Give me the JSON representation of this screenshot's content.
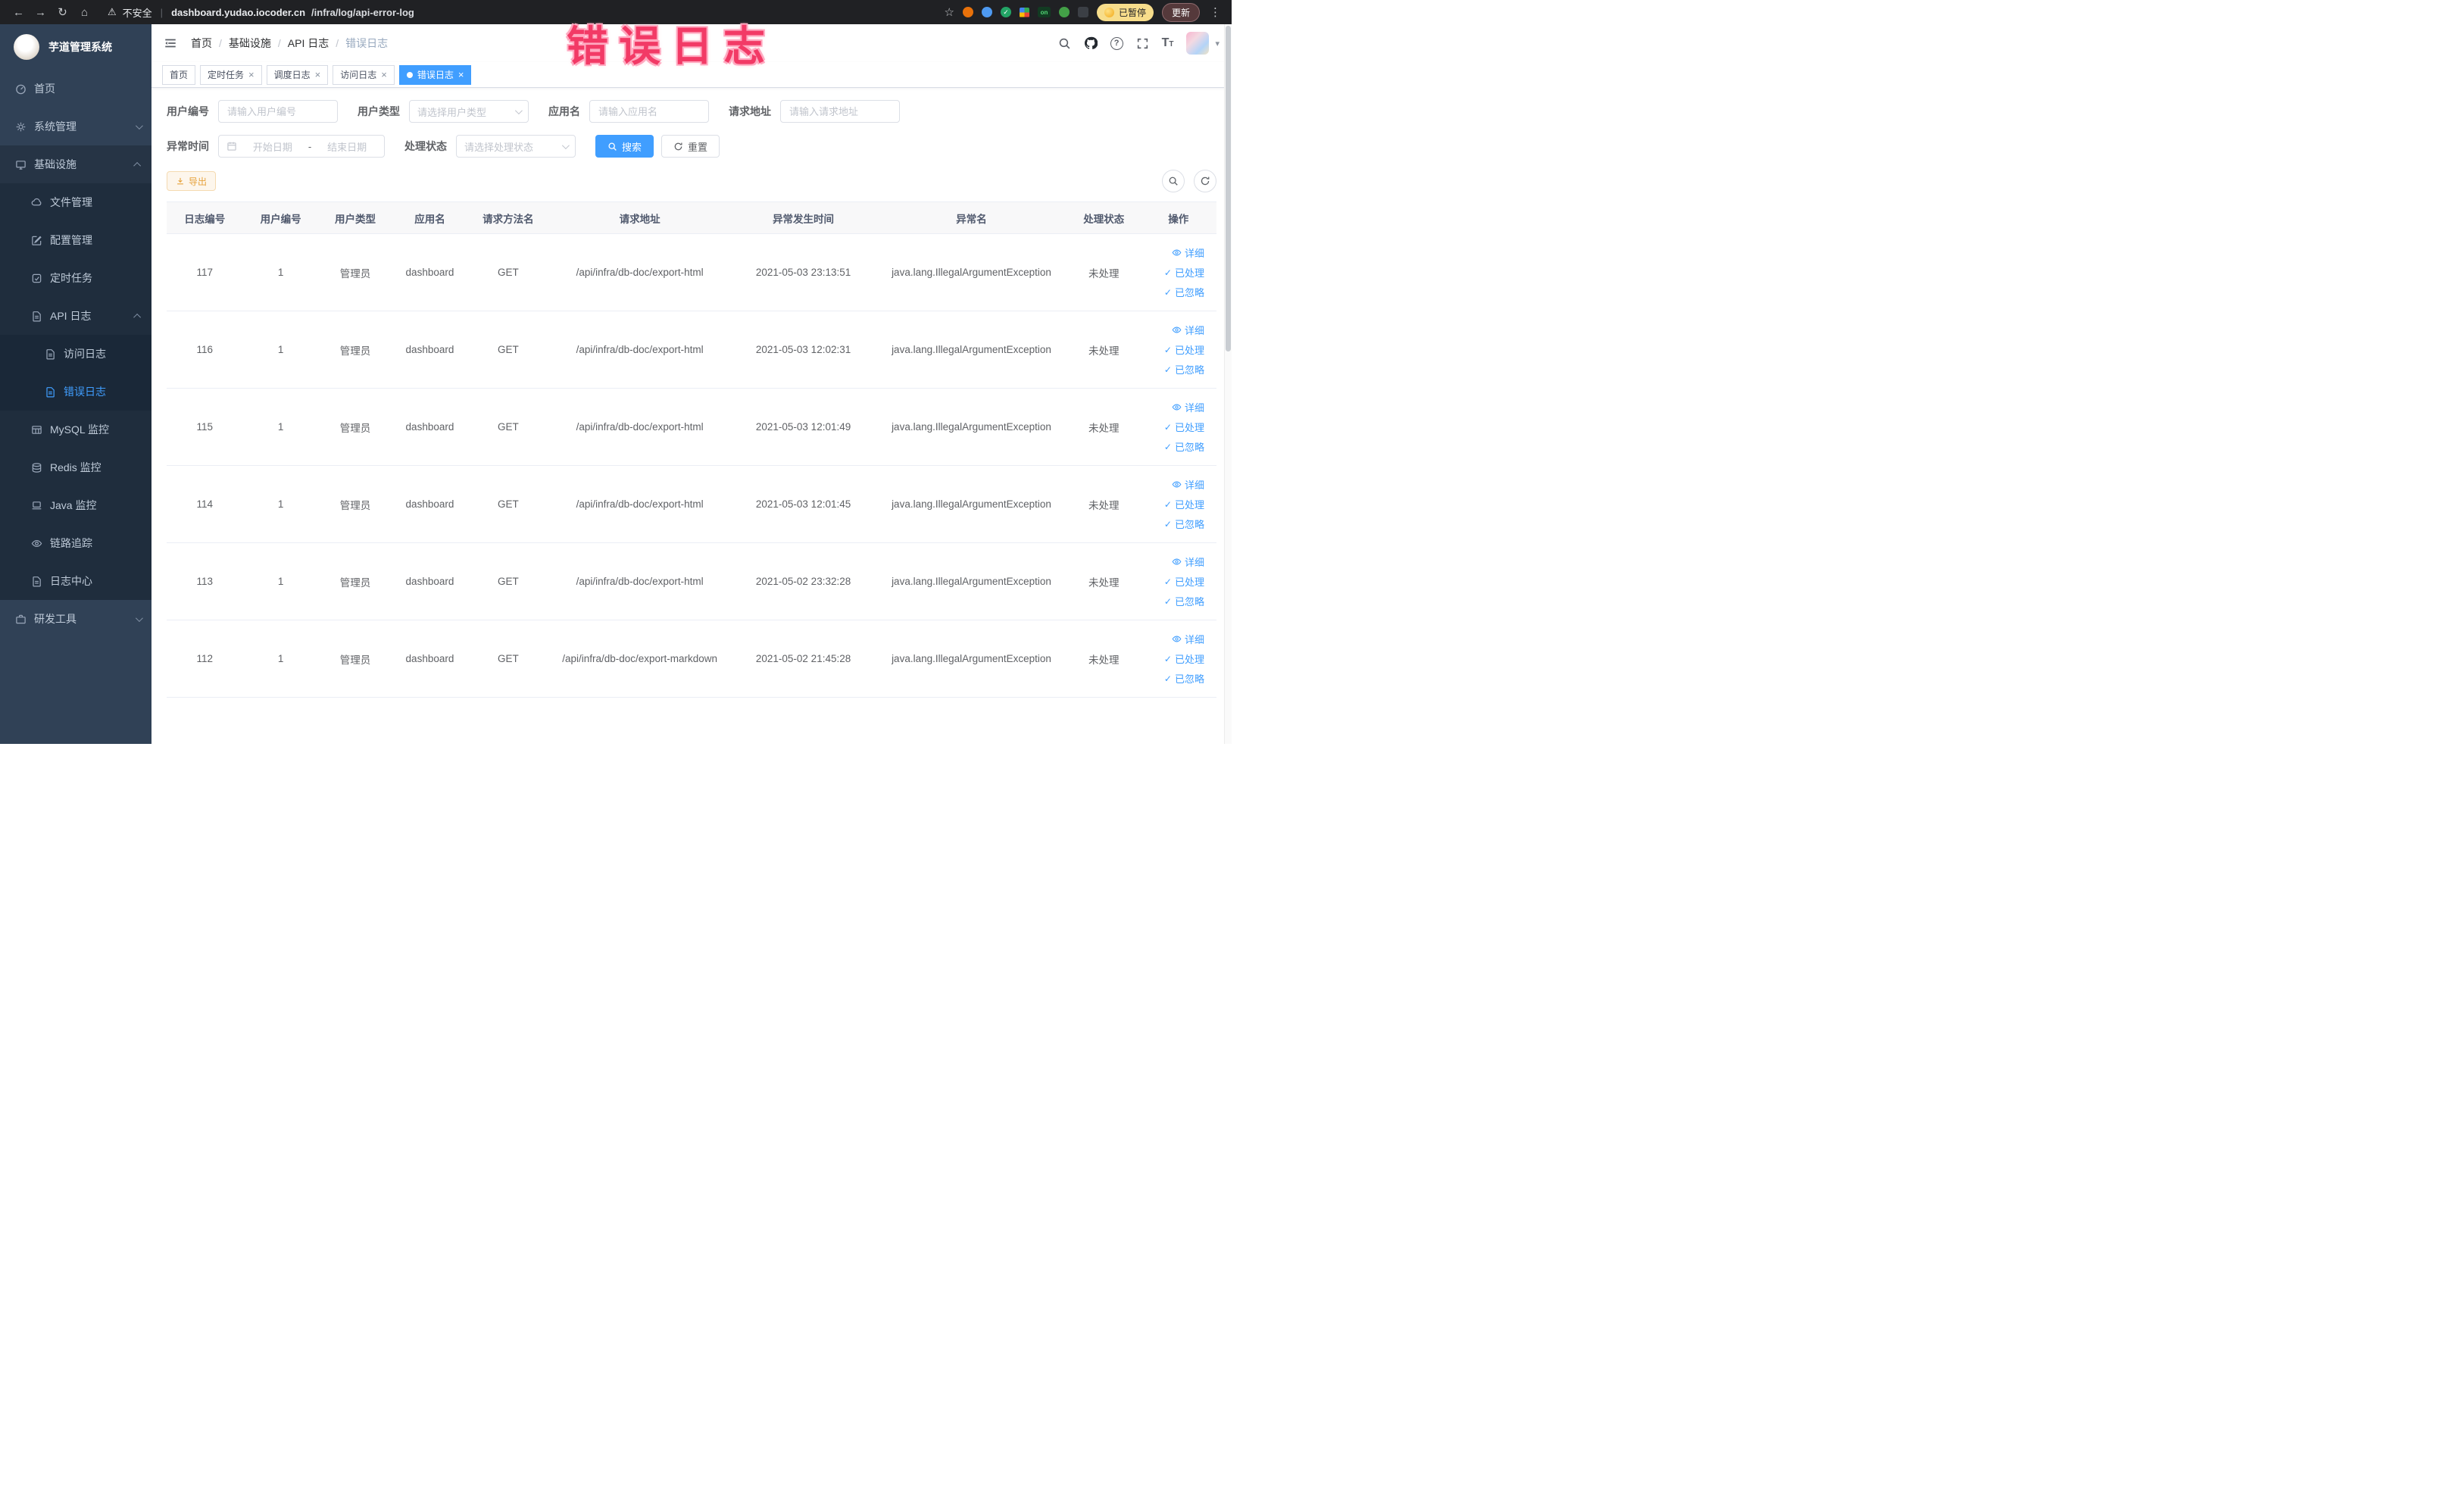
{
  "colors": {
    "accent": "#409eff",
    "warning": "#e6a23c",
    "annotation_pink": "#f23a66",
    "sidebar_bg": "#304156",
    "submenu_bg": "#1f2d3d"
  },
  "icons": {
    "back": "←",
    "forward": "→",
    "reload": "↻",
    "home": "⌂",
    "warning": "⚠",
    "divider": "|",
    "star": "☆",
    "kebab": "⋮",
    "caret_down": "▾",
    "question": "?",
    "check": "✓",
    "close": "×",
    "font_large": "T",
    "font_small": "T"
  },
  "browser": {
    "security_label": "不安全",
    "url_host": "dashboard.yudao.iocoder.cn",
    "url_path": "/infra/log/api-error-log",
    "extensions_on_label": "on",
    "paused_label": "已暂停",
    "update_label": "更新"
  },
  "annotation": {
    "text": "错误日志"
  },
  "sidebar": {
    "title": "芋道管理系统",
    "items": [
      {
        "label": "首页"
      },
      {
        "label": "系统管理"
      },
      {
        "label": "基础设施"
      },
      {
        "label": "文件管理"
      },
      {
        "label": "配置管理"
      },
      {
        "label": "定时任务"
      },
      {
        "label": "API 日志"
      },
      {
        "label": "访问日志"
      },
      {
        "label": "错误日志"
      },
      {
        "label": "MySQL 监控"
      },
      {
        "label": "Redis 监控"
      },
      {
        "label": "Java 监控"
      },
      {
        "label": "链路追踪"
      },
      {
        "label": "日志中心"
      },
      {
        "label": "研发工具"
      }
    ]
  },
  "header": {
    "breadcrumb": [
      "首页",
      "基础设施",
      "API 日志",
      "错误日志"
    ],
    "breadcrumb_separator": "/"
  },
  "tabs": [
    {
      "label": "首页"
    },
    {
      "label": "定时任务"
    },
    {
      "label": "调度日志"
    },
    {
      "label": "访问日志"
    },
    {
      "label": "错误日志"
    }
  ],
  "filters": {
    "user_id": {
      "label": "用户编号",
      "placeholder": "请输入用户编号"
    },
    "user_type": {
      "label": "用户类型",
      "placeholder": "请选择用户类型"
    },
    "app_name": {
      "label": "应用名",
      "placeholder": "请输入应用名"
    },
    "request_url": {
      "label": "请求地址",
      "placeholder": "请输入请求地址"
    },
    "exception_time": {
      "label": "异常时间",
      "start_placeholder": "开始日期",
      "separator": "-",
      "end_placeholder": "结束日期"
    },
    "process_status": {
      "label": "处理状态",
      "placeholder": "请选择处理状态"
    },
    "search_label": "搜索",
    "reset_label": "重置"
  },
  "toolbar": {
    "export_label": "导出"
  },
  "table": {
    "columns": [
      "日志编号",
      "用户编号",
      "用户类型",
      "应用名",
      "请求方法名",
      "请求地址",
      "异常发生时间",
      "异常名",
      "处理状态",
      "操作"
    ],
    "actions": {
      "detail": "详细",
      "processed": "已处理",
      "ignored": "已忽略"
    },
    "rows": [
      {
        "id": "117",
        "user_id": "1",
        "user_type": "管理员",
        "app": "dashboard",
        "method": "GET",
        "url": "/api/infra/db-doc/export-html",
        "time": "2021-05-03 23:13:51",
        "exception": "java.lang.IllegalArgumentException",
        "status": "未处理"
      },
      {
        "id": "116",
        "user_id": "1",
        "user_type": "管理员",
        "app": "dashboard",
        "method": "GET",
        "url": "/api/infra/db-doc/export-html",
        "time": "2021-05-03 12:02:31",
        "exception": "java.lang.IllegalArgumentException",
        "status": "未处理"
      },
      {
        "id": "115",
        "user_id": "1",
        "user_type": "管理员",
        "app": "dashboard",
        "method": "GET",
        "url": "/api/infra/db-doc/export-html",
        "time": "2021-05-03 12:01:49",
        "exception": "java.lang.IllegalArgumentException",
        "status": "未处理"
      },
      {
        "id": "114",
        "user_id": "1",
        "user_type": "管理员",
        "app": "dashboard",
        "method": "GET",
        "url": "/api/infra/db-doc/export-html",
        "time": "2021-05-03 12:01:45",
        "exception": "java.lang.IllegalArgumentException",
        "status": "未处理"
      },
      {
        "id": "113",
        "user_id": "1",
        "user_type": "管理员",
        "app": "dashboard",
        "method": "GET",
        "url": "/api/infra/db-doc/export-html",
        "time": "2021-05-02 23:32:28",
        "exception": "java.lang.IllegalArgumentException",
        "status": "未处理"
      },
      {
        "id": "112",
        "user_id": "1",
        "user_type": "管理员",
        "app": "dashboard",
        "method": "GET",
        "url": "/api/infra/db-doc/export-markdown",
        "time": "2021-05-02 21:45:28",
        "exception": "java.lang.IllegalArgumentException",
        "status": "未处理"
      }
    ]
  }
}
